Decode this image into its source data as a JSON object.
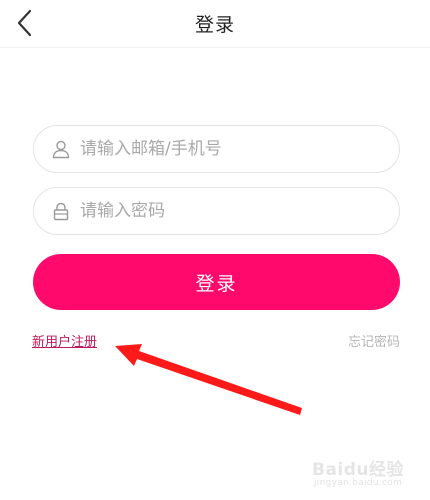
{
  "header": {
    "title": "登录",
    "back_icon": "chevron-left-icon"
  },
  "form": {
    "account": {
      "placeholder": "请输入邮箱/手机号",
      "value": "",
      "icon": "user-icon"
    },
    "password": {
      "placeholder": "请输入密码",
      "value": "",
      "icon": "lock-icon"
    },
    "login_label": "登录"
  },
  "links": {
    "register": "新用户注册",
    "forgot_password": "忘记密码"
  },
  "annotation": {
    "arrow_color": "#ff1a1a"
  },
  "watermark": {
    "brand": "Baidu经验",
    "url": "jingyan.baidu.com"
  },
  "colors": {
    "accent": "#ff0a6c",
    "register_link": "#c0175e",
    "muted": "#b5b5b5"
  }
}
